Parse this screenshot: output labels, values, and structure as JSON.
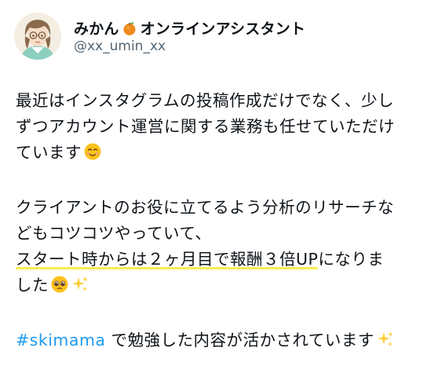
{
  "user": {
    "display_name": "みかん",
    "display_name_suffix": "オンラインアシスタント",
    "name_emoji": "tangerine-icon",
    "handle": "@xx_umin_xx"
  },
  "tweet": {
    "para1_line1": "最近はインスタグラムの投稿作成だけでなく、少し",
    "para1_line2": "ずつアカウント運営に関する業務も任せていただけ",
    "para1_line3": "ています",
    "para2_line1": "クライアントのお役に立てるよう分析のリサーチな",
    "para2_line2": "どもコツコツやっていて、",
    "para2_line3_highlight": "スタート時からは２ヶ月目で報酬３倍UP",
    "para2_line3_rest": "になりま",
    "para2_line4": "した",
    "hashtag": "#skimama",
    "para3_rest": " で勉強した内容が活かされています",
    "emojis": [
      "smiling-face-icon",
      "pleading-face-icon",
      "sparkles-icon",
      "sparkles-icon"
    ]
  },
  "colors": {
    "hashtag": "#1d9bf0",
    "highlight": "#f7ee4d",
    "handle": "#536471",
    "text": "#0f1419"
  }
}
